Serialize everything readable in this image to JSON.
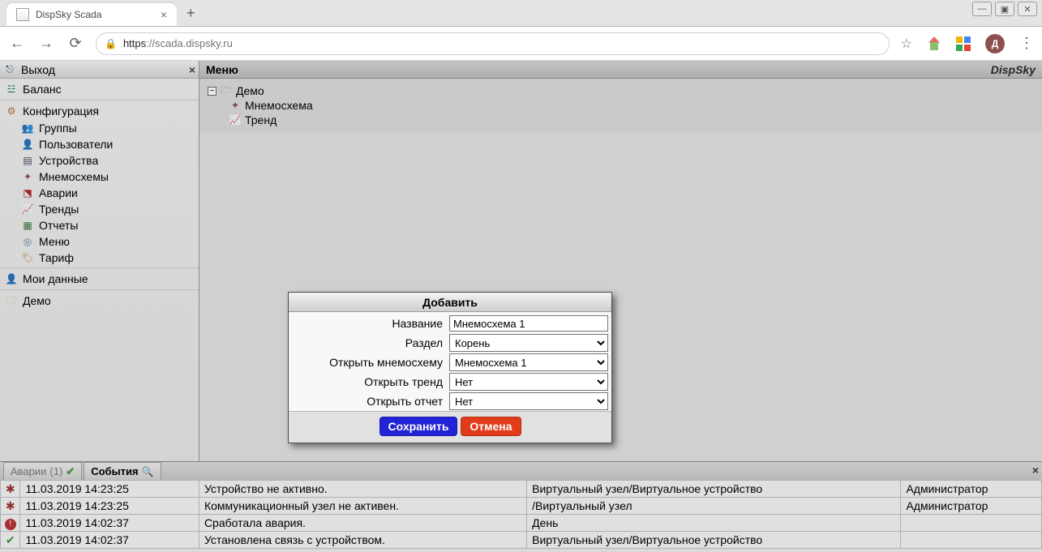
{
  "browser": {
    "tab_title": "DispSky Scada",
    "url_scheme": "https",
    "url_rest": "://scada.dispsky.ru",
    "avatar_letter": "Д"
  },
  "sidebar": {
    "exit": "Выход",
    "balance": "Баланс",
    "config": "Конфигурация",
    "items": {
      "groups": "Группы",
      "users": "Пользователи",
      "devices": "Устройства",
      "mnemos": "Мнемосхемы",
      "alarms": "Аварии",
      "trends": "Тренды",
      "reports": "Отчеты",
      "menu": "Меню",
      "tariff": "Тариф"
    },
    "mydata": "Мои данные",
    "demo": "Демо"
  },
  "main": {
    "header": "Меню",
    "brand": "DispSky",
    "tree": {
      "root": "Демо",
      "mnemo": "Мнемосхема",
      "trend": "Тренд"
    }
  },
  "dialog": {
    "title": "Добавить",
    "labels": {
      "name": "Название",
      "section": "Раздел",
      "open_mnemo": "Открыть мнемосхему",
      "open_trend": "Открыть тренд",
      "open_report": "Открыть отчет"
    },
    "values": {
      "name": "Мнемосхема 1",
      "section": "Корень",
      "open_mnemo": "Мнемосхема 1",
      "open_trend": "Нет",
      "open_report": "Нет"
    },
    "buttons": {
      "save": "Сохранить",
      "cancel": "Отмена"
    }
  },
  "bottom": {
    "tab_alarm": "Аварии",
    "tab_alarm_count": "(1)",
    "tab_events": "События",
    "rows": [
      {
        "icon": "bug",
        "time": "11.03.2019 14:23:25",
        "msg": "Устройство не активно.",
        "src": "Виртуальный узел/Виртуальное устройство",
        "user": "Администратор"
      },
      {
        "icon": "bug",
        "time": "11.03.2019 14:23:25",
        "msg": "Коммуникационный узел не активен.",
        "src": "/Виртуальный узел",
        "user": "Администратор"
      },
      {
        "icon": "err",
        "time": "11.03.2019 14:02:37",
        "msg": "Сработала авария.",
        "src": "День",
        "user": ""
      },
      {
        "icon": "ok",
        "time": "11.03.2019 14:02:37",
        "msg": "Установлена связь с устройством.",
        "src": "Виртуальный узел/Виртуальное устройство",
        "user": ""
      }
    ]
  }
}
